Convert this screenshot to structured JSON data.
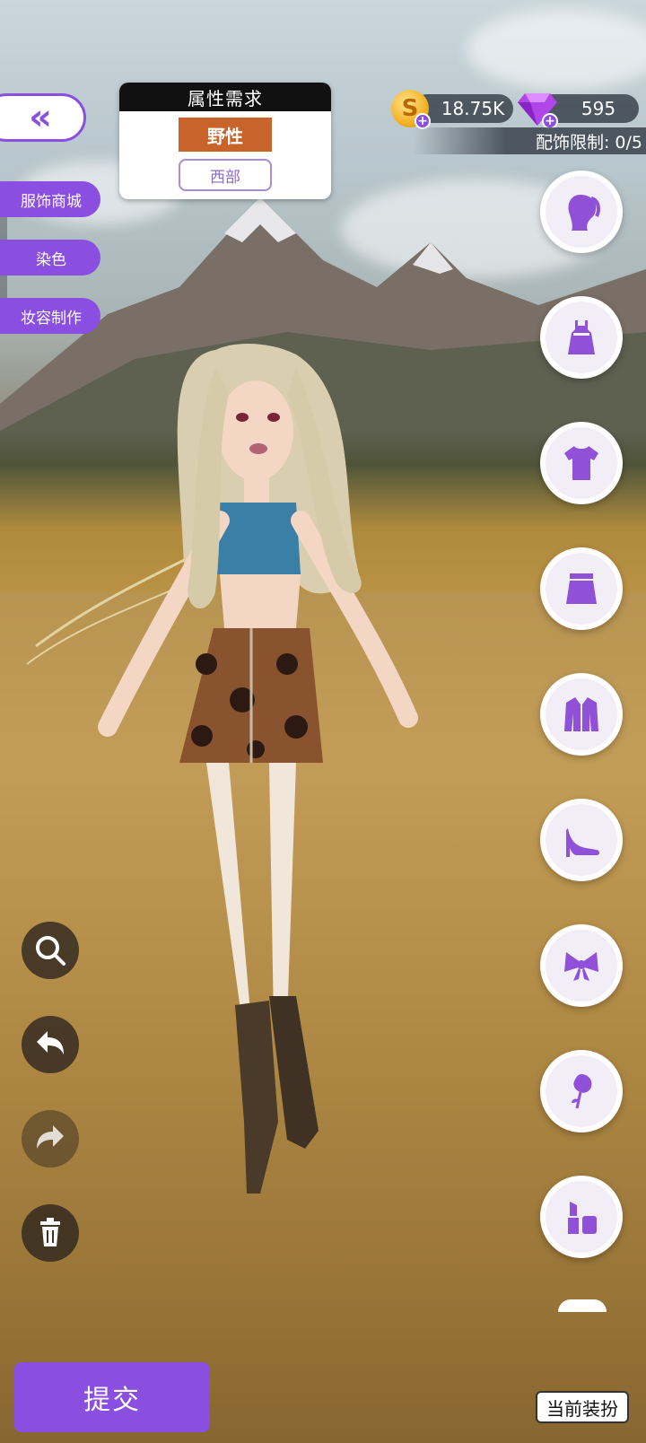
{
  "header": {
    "back_icon": "double-chevron-left-icon"
  },
  "requirement": {
    "title": "属性需求",
    "main_attribute": "野性",
    "sub_attribute": "西部"
  },
  "side_menu": {
    "items": [
      {
        "label": "服饰商城"
      },
      {
        "label": "染色"
      },
      {
        "label": "妆容制作"
      }
    ]
  },
  "currency": {
    "coins": "18.75K",
    "gems": "595",
    "coin_icon": "coin-icon",
    "gem_icon": "diamond-icon",
    "accessory_limit": "配饰限制: 0/5"
  },
  "categories": [
    {
      "icon": "hair-icon"
    },
    {
      "icon": "dress-icon"
    },
    {
      "icon": "top-icon"
    },
    {
      "icon": "skirt-icon"
    },
    {
      "icon": "jacket-icon"
    },
    {
      "icon": "high-heel-icon"
    },
    {
      "icon": "bow-icon"
    },
    {
      "icon": "rose-icon"
    },
    {
      "icon": "lipstick-icon"
    }
  ],
  "tools": [
    {
      "icon": "zoom-icon"
    },
    {
      "icon": "undo-icon"
    },
    {
      "icon": "redo-icon"
    },
    {
      "icon": "trash-icon"
    }
  ],
  "footer": {
    "submit_label": "提交",
    "current_outfit_label": "当前装扮"
  },
  "colors": {
    "accent": "#8a4ee0",
    "attribute_main": "#c8642a"
  }
}
